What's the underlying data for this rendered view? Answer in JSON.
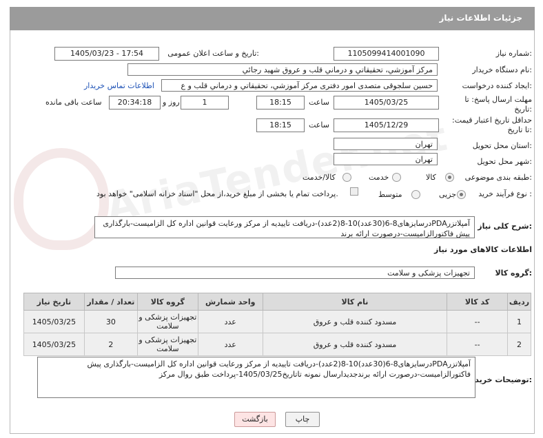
{
  "header": {
    "title": "جزئیات اطلاعات نیاز"
  },
  "fields": {
    "need_number_label": "شماره نیاز:",
    "need_number": "1105099414001090",
    "announce_label": "تاریخ و ساعت اعلان عمومی:",
    "announce_value": "1405/03/23 - 17:54",
    "buyer_org_label": "نام دستگاه خریدار:",
    "buyer_org": "مرکز آموزشي، تحقيقاتي و درماني قلب و عروق شهيد رجائي",
    "creator_label": "ایجاد کننده درخواست:",
    "creator": "حسین سلجوقی متصدی امور دفتری مرکز آموزشي، تحقيقاتي و درماني قلب و ع",
    "contact_link": "اطلاعات تماس خریدار",
    "deadline_label": "مهلت ارسال پاسخ: تا تاریخ:",
    "deadline_date": "1405/03/25",
    "hour_word": "ساعت",
    "deadline_time": "18:15",
    "days_value": "1",
    "days_word": "روز و",
    "remaining_time": "20:34:18",
    "remaining_word": "ساعت باقی مانده",
    "validity_label": "حداقل تاریخ اعتبار قیمت: تا تاریخ:",
    "validity_date": "1405/12/29",
    "validity_time": "18:15",
    "province_label": "استان محل تحویل:",
    "province": "تهران",
    "city_label": "شهر محل تحویل:",
    "city": "تهران",
    "category_label": "طبقه بندی موضوعی:",
    "category_options": [
      "کالا",
      "خدمت",
      "کالا/خدمت"
    ],
    "category_selected": "کالا",
    "process_label": "نوع فرآیند خرید :",
    "process_options": [
      "جزیی",
      "متوسط"
    ],
    "process_selected": "جزیی",
    "payment_note": "پرداخت تمام یا بخشی از مبلغ خرید،از محل \"اسناد خزانه اسلامی\" خواهد بود."
  },
  "summary": {
    "label": "شرح کلی نیاز:",
    "text": "آمپلاتزرPDAدرسایزهای8-6(30عدد)10-8(2عدد)-دریافت تاییدیه از مرکز ورعایت قوانین اداره کل الزامیست-بارگذاری پیش فاکتورالزامیست-درصورت ارائه برند"
  },
  "goods": {
    "section_title": "اطلاعات کالاهای مورد نیاز",
    "group_label": "گروه کالا:",
    "group_value": "تجهیزات پزشکی و سلامت",
    "columns": [
      "ردیف",
      "کد کالا",
      "نام کالا",
      "واحد شمارش",
      "گروه کالا",
      "تعداد / مقدار",
      "تاریخ نیاز"
    ],
    "rows": [
      {
        "index": "1",
        "code": "--",
        "name": "مسدود کننده قلب و عروق",
        "unit": "عدد",
        "group": "تجهیزات پزشکی و سلامت",
        "qty": "30",
        "date": "1405/03/25"
      },
      {
        "index": "2",
        "code": "--",
        "name": "مسدود کننده قلب و عروق",
        "unit": "عدد",
        "group": "تجهیزات پزشکی و سلامت",
        "qty": "2",
        "date": "1405/03/25"
      }
    ]
  },
  "buyer_notes": {
    "label": "توضیحات خریدار:",
    "text": "آمپلاتزرPDAدرسایزهای8-6(30عدد)10-8(2عدد)-دریافت تاییدیه از مرکز ورعایت قوانین اداره کل الزامیست-بارگذاری پیش فاکتورالزامیست-درصورت ارائه برندجدیدارسال نمونه تاتاریخ1405/03/25-پرداخت طبق روال مرکز"
  },
  "buttons": {
    "print": "چاپ",
    "back": "بازگشت"
  },
  "watermark": {
    "text": "AriaTender.net"
  }
}
